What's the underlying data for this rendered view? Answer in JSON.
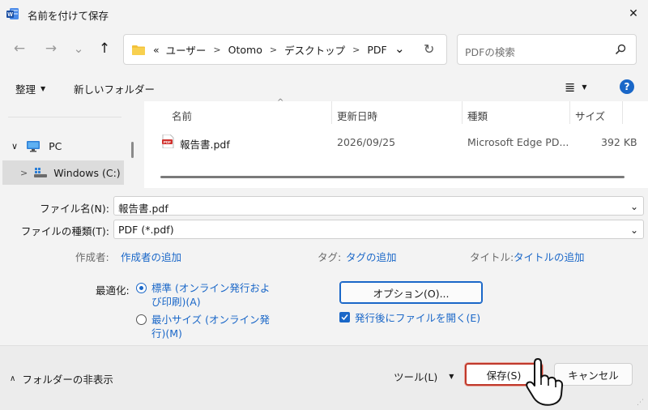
{
  "window": {
    "title": "名前を付けて保存",
    "close_glyph": "✕"
  },
  "nav": {
    "back": "←",
    "forward": "→",
    "recent": "⌄",
    "up": "↑"
  },
  "address": {
    "overflow": "«",
    "crumbs": [
      "ユーザー",
      "Otomo",
      "デスクトップ",
      "PDF"
    ],
    "chevron": "⌄",
    "refresh": "↻"
  },
  "search": {
    "placeholder": "PDFの検索"
  },
  "toolbar": {
    "organize": "整理",
    "new_folder": "新しいフォルダー",
    "view": "≣",
    "help": "?"
  },
  "navpane": {
    "pc": "PC",
    "drive": "Windows (C:)"
  },
  "filelist": {
    "columns": [
      "名前",
      "更新日時",
      "種類",
      "サイズ"
    ],
    "rows": [
      {
        "name": "報告書.pdf",
        "date": "2026/09/25",
        "type": "Microsoft Edge PD...",
        "size": "392 KB",
        "icon_label": "PDF"
      }
    ]
  },
  "form": {
    "filename_label": "ファイル名(N):",
    "filename_value": "報告書.pdf",
    "filetype_label": "ファイルの種類(T):",
    "filetype_value": "PDF (*.pdf)",
    "author_label": "作成者:",
    "author_value": "作成者の追加",
    "tag_label": "タグ:",
    "tag_value": "タグの追加",
    "title_label": "タイトル:",
    "title_value": "タイトルの追加",
    "optimize_label": "最適化:",
    "opt_standard_1": "標準 (オンライン発行およ",
    "opt_standard_2": "び印刷)(A)",
    "opt_min_1": "最小サイズ (オンライン発",
    "opt_min_2": "行)(M)",
    "options_button": "オプション(O)...",
    "open_after": "発行後にファイルを開く(E)"
  },
  "footer": {
    "hide_folders": "フォルダーの非表示",
    "tools": "ツール(L)",
    "save": "保存(S)",
    "cancel": "キャンセル"
  },
  "colors": {
    "accent": "#1a67c8",
    "save_outline": "#c0392b",
    "pdf_red": "#d0312d"
  }
}
